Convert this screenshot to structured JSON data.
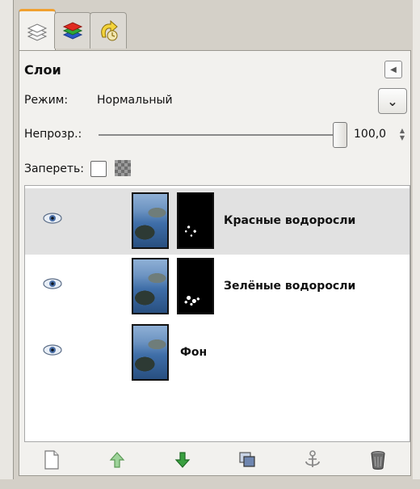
{
  "dialog": {
    "tabs": [
      {
        "icon": "layers-icon",
        "active": true
      },
      {
        "icon": "channels-icon",
        "active": false
      },
      {
        "icon": "undo-history-icon",
        "active": false
      }
    ],
    "title": "Слои",
    "menu_icon": "tab-menu-icon"
  },
  "mode": {
    "label": "Режим:",
    "value": "Нормальный",
    "dropdown_icon": "chevron-down-icon"
  },
  "opacity": {
    "label": "Непрозр.:",
    "value": "100,0",
    "level": 1.0
  },
  "lock": {
    "label": "Запереть:",
    "pixels_checked": false,
    "alpha_icon": "lock-alpha-icon"
  },
  "layers": [
    {
      "name": "Красные водоросли",
      "visible": true,
      "selected": true,
      "has_mask": true
    },
    {
      "name": "Зелёные водоросли",
      "visible": true,
      "selected": false,
      "has_mask": true
    },
    {
      "name": "Фон",
      "visible": true,
      "selected": false,
      "has_mask": false
    }
  ],
  "toolbar": [
    {
      "icon": "new-layer-icon"
    },
    {
      "icon": "raise-layer-icon"
    },
    {
      "icon": "lower-layer-icon"
    },
    {
      "icon": "duplicate-layer-icon"
    },
    {
      "icon": "anchor-layer-icon"
    },
    {
      "icon": "delete-layer-icon"
    }
  ],
  "colors": {
    "selected_row": "#e1e1e1",
    "raise_arrow": "#3aa040",
    "active_tab_accent": "#f0a030"
  }
}
